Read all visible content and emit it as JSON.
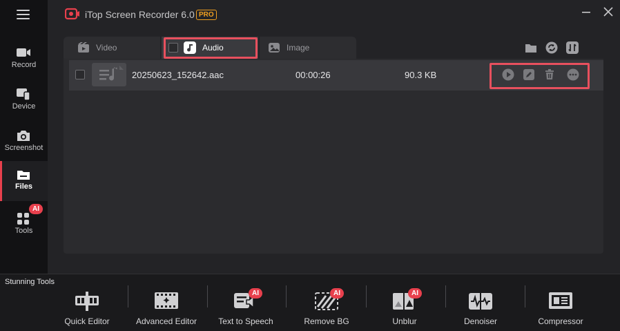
{
  "app": {
    "title": "iTop Screen Recorder 6.0",
    "badge": "PRO"
  },
  "sidebar": {
    "items": [
      {
        "label": "Record"
      },
      {
        "label": "Device"
      },
      {
        "label": "Screenshot"
      },
      {
        "label": "Files",
        "active": true
      },
      {
        "label": "Tools",
        "badge": "AI"
      }
    ]
  },
  "tabs": [
    {
      "label": "Video"
    },
    {
      "label": "Audio",
      "active": true
    },
    {
      "label": "Image"
    }
  ],
  "files": [
    {
      "name": "20250623_152642.aac",
      "duration": "00:00:26",
      "size": "90.3 KB"
    }
  ],
  "stunning": {
    "heading": "Stunning Tools",
    "items": [
      {
        "label": "Quick Editor"
      },
      {
        "label": "Advanced Editor"
      },
      {
        "label": "Text to Speech",
        "badge": "AI"
      },
      {
        "label": "Remove BG",
        "badge": "AI"
      },
      {
        "label": "Unblur",
        "badge": "AI"
      },
      {
        "label": "Denoiser"
      },
      {
        "label": "Compressor"
      }
    ]
  },
  "colors": {
    "accent": "#e8404d",
    "pro": "#f0a020",
    "highlight": "#e8505e"
  }
}
